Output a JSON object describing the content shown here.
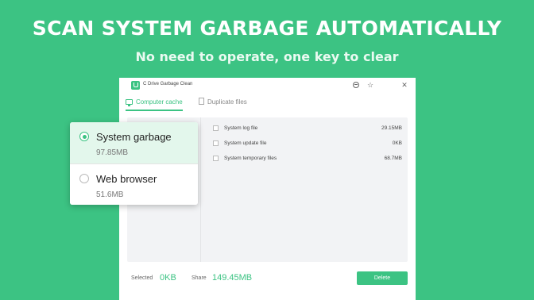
{
  "banner": {
    "headline": "SCAN SYSTEM GARBAGE AUTOMATICALLY",
    "subline": "No need to operate, one key to clear"
  },
  "window": {
    "title": "C Drive Garbage Clean",
    "tabs": [
      {
        "label": "Computer cache",
        "active": true,
        "icon": "monitor-icon"
      },
      {
        "label": "Duplicate files",
        "active": false,
        "icon": "file-icon"
      }
    ],
    "files": [
      {
        "name": "System log file",
        "size": "29.15MB"
      },
      {
        "name": "System update file",
        "size": "0KB"
      },
      {
        "name": "System temporary files",
        "size": "68.7MB"
      }
    ],
    "footer": {
      "selected_label": "Selected",
      "selected_value": "0KB",
      "share_label": "Share",
      "share_value": "149.45MB",
      "delete_label": "Delete"
    }
  },
  "popup": {
    "options": [
      {
        "name": "System garbage",
        "size": "97.85MB",
        "checked": true
      },
      {
        "name": "Web browser",
        "size": "51.6MB",
        "checked": false
      }
    ]
  },
  "colors": {
    "accent": "#3cc383",
    "selected_bg": "#e3f7ec"
  }
}
